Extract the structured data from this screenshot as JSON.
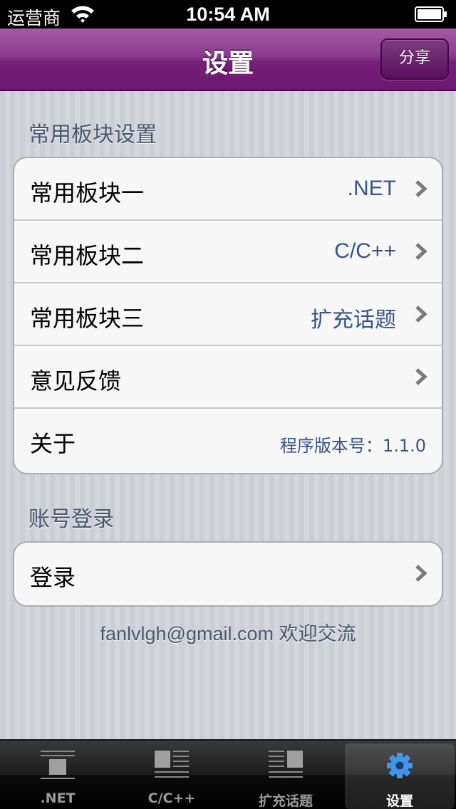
{
  "status_bar": {
    "carrier": "运营商",
    "time": "10:54 AM"
  },
  "nav": {
    "title": "设置",
    "share_label": "分享"
  },
  "sections": [
    {
      "header": "常用板块设置",
      "cells": [
        {
          "label": "常用板块一",
          "value": ".NET",
          "chevron": true
        },
        {
          "label": "常用板块二",
          "value": "C/C++",
          "chevron": true
        },
        {
          "label": "常用板块三",
          "value": "扩充话题",
          "chevron": true
        },
        {
          "label": "意见反馈",
          "value": "",
          "chevron": true
        },
        {
          "label": "关于",
          "value": "程序版本号：1.1.0",
          "chevron": false
        }
      ]
    },
    {
      "header": "账号登录",
      "cells": [
        {
          "label": "登录",
          "value": "",
          "chevron": true
        }
      ]
    }
  ],
  "footer_note": "fanlvlgh@gmail.com 欢迎交流",
  "tab_bar": {
    "selected": 3,
    "tabs": [
      {
        "label": ".NET",
        "icon": "dotnet-board-icon"
      },
      {
        "label": "C/C++",
        "icon": "cpp-board-icon"
      },
      {
        "label": "扩充话题",
        "icon": "topics-board-icon"
      },
      {
        "label": "设置",
        "icon": "gear-icon"
      }
    ]
  },
  "colors": {
    "nav_purple": "#761f78",
    "cell_value_blue": "#385487",
    "section_header": "#4c566c",
    "selected_tab_icon": "#3f97ea"
  }
}
